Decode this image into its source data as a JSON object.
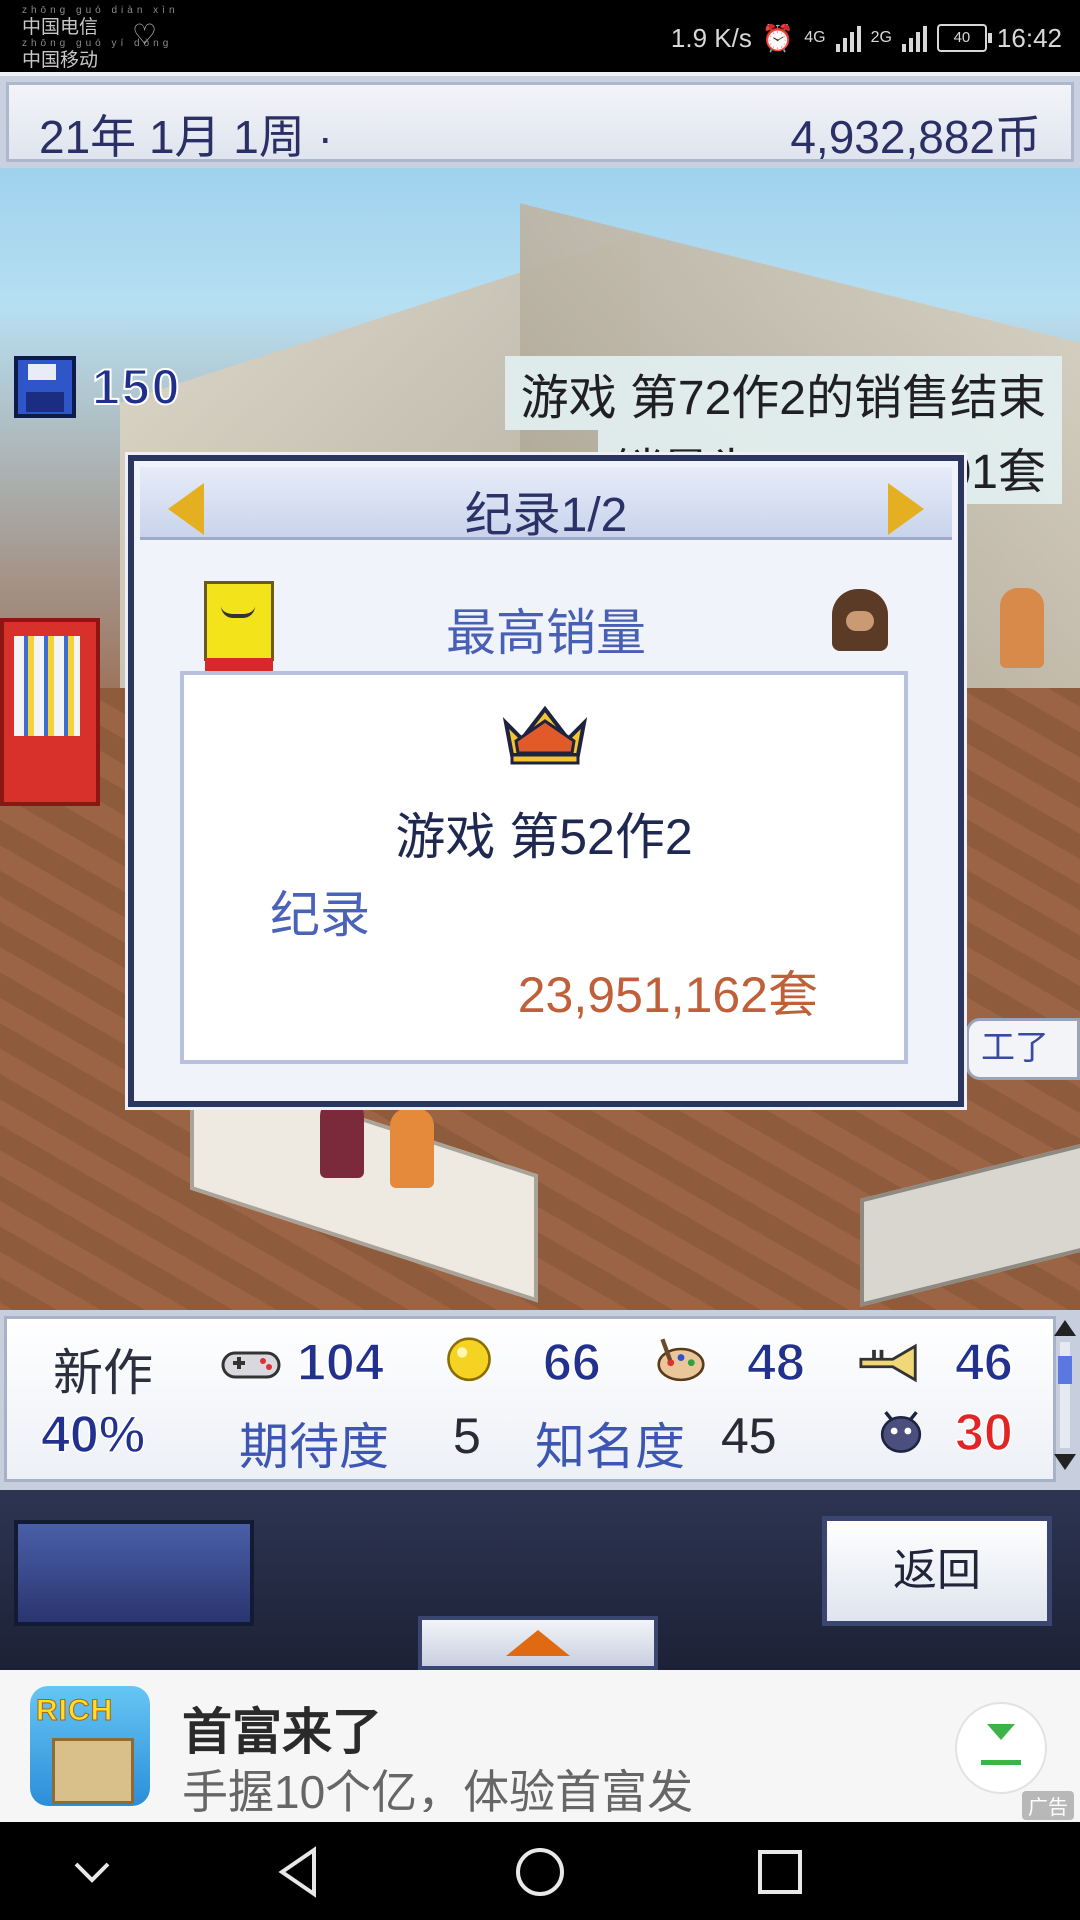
{
  "status_bar": {
    "carrier_1_pinyin": "zhōng guó diàn xìn",
    "carrier_1": "中国电信",
    "carrier_2_pinyin": "zhōng guó yí dòng",
    "carrier_2": "中国移动",
    "net_speed": "1.9 K/s",
    "network_1": "4G",
    "network_2": "2G",
    "battery": "40",
    "time": "16:42"
  },
  "top_bar": {
    "date": "21年 1月 1周 ·",
    "money": "4,932,882币"
  },
  "scene": {
    "research_points": "150",
    "notice_line_1": "游戏 第72作2的销售结束",
    "notice_line_2": "销量为12,807,701套",
    "worker_bubble": "工了"
  },
  "dialog": {
    "title": "纪录1/2",
    "subtitle": "最高销量",
    "game_name": "游戏 第52作2",
    "record_label": "纪录",
    "record_value": "23,951,162套"
  },
  "stats": {
    "new_work_label": "新作",
    "progress": "40%",
    "stat_fun": "104",
    "stat_creativity": "66",
    "stat_graphics": "48",
    "stat_sound": "46",
    "expectation_label": "期待度",
    "expectation_value": "5",
    "fame_label": "知名度",
    "fame_value": "45",
    "bugs": "30"
  },
  "controls": {
    "back_label": "返回"
  },
  "ad": {
    "icon_logo": "RICH",
    "title": "首富来了",
    "description": "手握10个亿，体验首富发",
    "tag": "广告"
  },
  "colors": {
    "accent_blue": "#22318e",
    "record_orange": "#c0603a",
    "bug_red": "#e22424",
    "arrow_gold": "#e4b021"
  }
}
